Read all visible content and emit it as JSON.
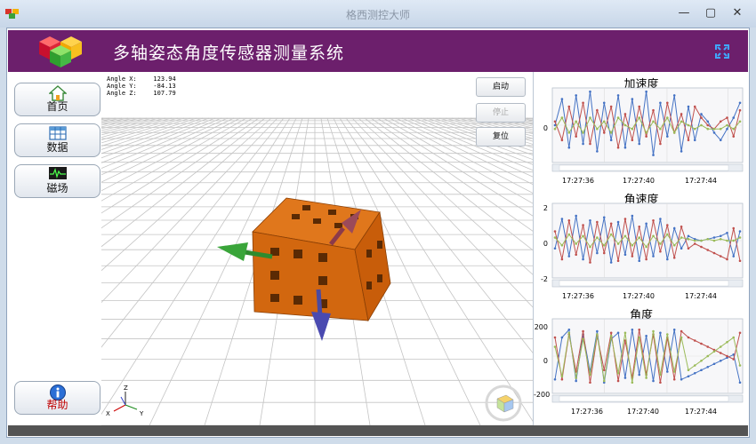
{
  "window": {
    "title": "格西测控大师",
    "minimize_label": "—",
    "maximize_label": "▢",
    "close_label": "✕"
  },
  "header": {
    "title": "多轴姿态角度传感器测量系统"
  },
  "nav": {
    "items": [
      {
        "label": "首页",
        "icon": "home-icon"
      },
      {
        "label": "数据",
        "icon": "table-icon"
      },
      {
        "label": "磁场",
        "icon": "waveform-icon"
      }
    ],
    "help_label": "帮助"
  },
  "viewport": {
    "angle_readout": [
      {
        "label": "Angle X:",
        "value": "123.94"
      },
      {
        "label": "Angle Y:",
        "value": "-84.13"
      },
      {
        "label": "Angle Z:",
        "value": "107.79"
      }
    ],
    "controls": {
      "start_label": "启动",
      "stop_label": "停止",
      "reset_label": "复位"
    },
    "axis_letters": {
      "z": "Z",
      "x": "X",
      "y": "Y"
    }
  },
  "colors": {
    "header_bg": "#6c1f6c",
    "series_blue": "#4472c4",
    "series_red": "#c0504d",
    "series_green": "#9bbb59",
    "cube_orange": "#d2670f"
  },
  "chart_data": [
    {
      "type": "line",
      "title": "加速度",
      "x_ticks": [
        "17:27:36",
        "17:27:40",
        "17:27:44"
      ],
      "y_ticks": [
        "0"
      ],
      "series": [
        {
          "values": [
            0.0,
            0.7,
            -0.6,
            0.8,
            -0.5,
            0.9,
            -0.7,
            0.6,
            -0.4,
            0.8,
            -0.6,
            0.7,
            -0.5,
            0.9,
            -0.8,
            0.6,
            -0.3,
            0.8,
            -0.7,
            0.5,
            -0.4,
            0.3,
            0.1,
            -0.2,
            -0.4,
            -0.1,
            0.2,
            0.6
          ]
        },
        {
          "values": [
            0.1,
            -0.4,
            0.5,
            -0.3,
            0.6,
            -0.5,
            0.4,
            -0.2,
            0.5,
            -0.6,
            0.3,
            -0.4,
            0.5,
            -0.3,
            0.4,
            -0.5,
            0.6,
            -0.2,
            0.3,
            -0.4,
            0.5,
            0.2,
            0.0,
            -0.1,
            0.1,
            0.2,
            -0.3,
            0.4
          ]
        },
        {
          "values": [
            -0.1,
            0.2,
            -0.2,
            0.1,
            -0.2,
            0.2,
            -0.1,
            0.1,
            -0.2,
            0.2,
            0.0,
            -0.1,
            0.2,
            -0.2,
            0.1,
            -0.1,
            0.2,
            -0.2,
            0.1,
            0.0,
            -0.1,
            0.0,
            -0.1,
            -0.1,
            -0.1,
            0.0,
            -0.1,
            0.1
          ]
        }
      ]
    },
    {
      "type": "line",
      "title": "角速度",
      "x_ticks": [
        "17:27:36",
        "17:27:40",
        "17:27:44"
      ],
      "y_ticks": [
        "2",
        "0",
        "-2"
      ],
      "series": [
        {
          "values": [
            -0.5,
            1.4,
            -1.0,
            1.6,
            -1.2,
            1.3,
            -0.8,
            1.5,
            -1.4,
            1.2,
            -0.9,
            1.6,
            -1.3,
            1.1,
            -1.0,
            1.4,
            -1.2,
            0.8,
            -0.5,
            0.3,
            0.1,
            0.0,
            0.1,
            0.2,
            0.3,
            0.5,
            -1.0,
            0.6
          ]
        },
        {
          "values": [
            0.6,
            -1.2,
            1.3,
            -0.9,
            1.0,
            -1.4,
            1.2,
            -0.8,
            1.1,
            -1.3,
            1.4,
            -1.0,
            0.9,
            -1.2,
            1.3,
            -0.7,
            1.0,
            -1.1,
            0.9,
            -0.5,
            -0.2,
            -0.4,
            -0.6,
            -0.8,
            -1.0,
            -1.2,
            0.8,
            -1.3
          ]
        },
        {
          "values": [
            0.2,
            -0.3,
            0.4,
            -0.2,
            0.3,
            -0.4,
            0.2,
            -0.3,
            0.4,
            -0.2,
            0.3,
            -0.3,
            0.2,
            -0.4,
            0.3,
            -0.2,
            0.4,
            -0.3,
            0.2,
            0.1,
            0.0,
            0.0,
            0.1,
            0.0,
            0.1,
            0.0,
            0.0,
            0.2
          ]
        }
      ]
    },
    {
      "type": "line",
      "title": "角度",
      "x_ticks": [
        "17:27:36",
        "17:27:40",
        "17:27:44"
      ],
      "y_ticks": [
        "200",
        "0",
        "-200"
      ],
      "series": [
        {
          "values": [
            -150,
            120,
            170,
            -160,
            140,
            -100,
            160,
            -170,
            110,
            150,
            -140,
            170,
            -120,
            130,
            -160,
            150,
            -100,
            170,
            -150,
            -130,
            -110,
            -90,
            -70,
            -50,
            -30,
            -10,
            10,
            -170
          ]
        },
        {
          "values": [
            120,
            -150,
            140,
            -100,
            160,
            -170,
            130,
            -90,
            150,
            -160,
            100,
            -140,
            170,
            -120,
            140,
            -170,
            120,
            -150,
            160,
            120,
            100,
            80,
            60,
            40,
            20,
            0,
            -20,
            150
          ]
        },
        {
          "values": [
            60,
            -130,
            150,
            -140,
            110,
            -120,
            140,
            -160,
            130,
            -110,
            150,
            -170,
            120,
            -140,
            160,
            -120,
            140,
            -100,
            120,
            -90,
            -60,
            -30,
            0,
            30,
            60,
            90,
            120,
            -60
          ]
        }
      ]
    }
  ]
}
